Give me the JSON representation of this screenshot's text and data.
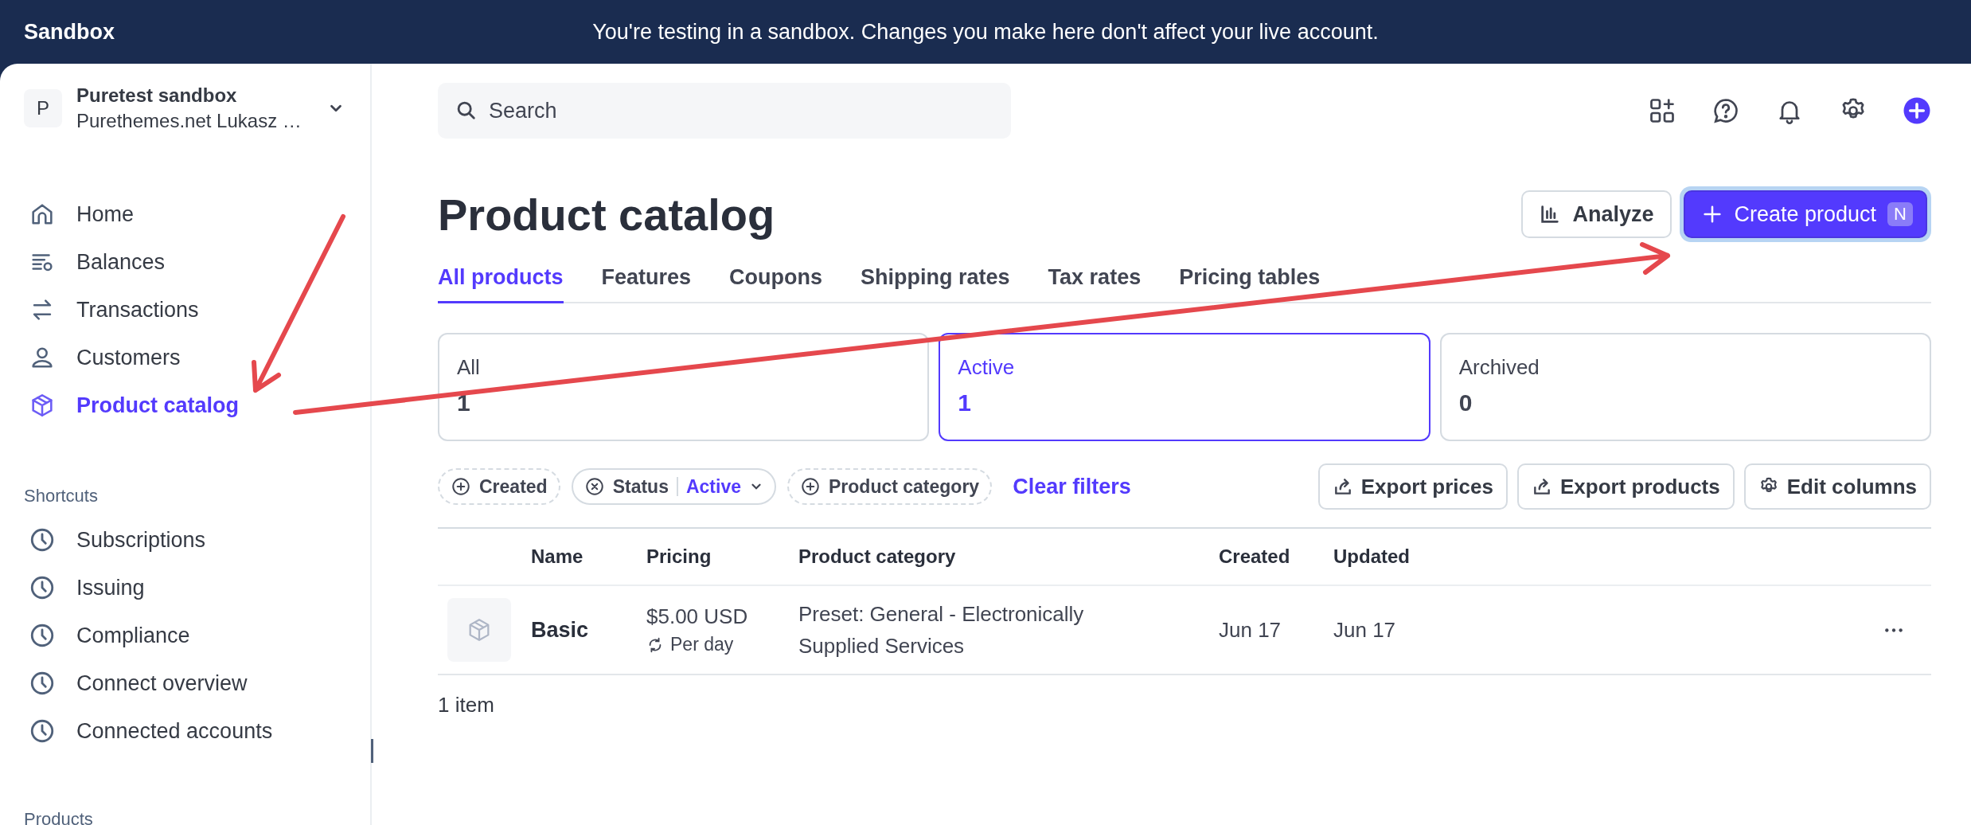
{
  "banner": {
    "label": "Sandbox",
    "message": "You're testing in a sandbox. Changes you make here don't affect your live account."
  },
  "account": {
    "initial": "P",
    "name": "Puretest sandbox",
    "subtitle": "Purethemes.net Lukasz …"
  },
  "nav": [
    {
      "label": "Home",
      "kind": "home",
      "selected": false
    },
    {
      "label": "Balances",
      "kind": "balances",
      "selected": false
    },
    {
      "label": "Transactions",
      "kind": "transfer",
      "selected": false
    },
    {
      "label": "Customers",
      "kind": "person",
      "selected": false
    },
    {
      "label": "Product catalog",
      "kind": "box",
      "selected": true
    }
  ],
  "shortcuts": {
    "title": "Shortcuts",
    "items": [
      {
        "label": "Subscriptions",
        "selected": false
      },
      {
        "label": "Issuing",
        "selected": false
      },
      {
        "label": "Compliance",
        "selected": false
      },
      {
        "label": "Connect overview",
        "selected": false
      },
      {
        "label": "Connected accounts",
        "selected": false
      }
    ]
  },
  "products_heading": "Products",
  "search": {
    "placeholder": "Search"
  },
  "header_icons": [
    {
      "kind": "apps"
    },
    {
      "kind": "help"
    },
    {
      "kind": "bell"
    },
    {
      "kind": "settings"
    },
    {
      "kind": "add"
    }
  ],
  "page_title": "Product catalog",
  "actions": [
    {
      "kind": "secondary",
      "label": "Analyze"
    },
    {
      "kind": "primary",
      "label": "Create product",
      "shortcut": "N"
    }
  ],
  "tabs": [
    {
      "label": "All products",
      "selected": true
    },
    {
      "label": "Features",
      "selected": false
    },
    {
      "label": "Coupons",
      "selected": false
    },
    {
      "label": "Shipping rates",
      "selected": false
    },
    {
      "label": "Tax rates",
      "selected": false
    },
    {
      "label": "Pricing tables",
      "selected": false
    }
  ],
  "status_cards": [
    {
      "label": "All",
      "count": "1",
      "selected": false
    },
    {
      "label": "Active",
      "count": "1",
      "selected": true
    },
    {
      "label": "Archived",
      "count": "0",
      "selected": false
    }
  ],
  "filters": [
    {
      "kind": "add",
      "label": "Created"
    },
    {
      "kind": "applied",
      "label": "Status",
      "value": "Active"
    },
    {
      "kind": "add",
      "label": "Product category"
    }
  ],
  "clear_filters": "Clear filters",
  "tools": [
    {
      "kind": "export",
      "label": "Export prices"
    },
    {
      "kind": "export",
      "label": "Export products"
    },
    {
      "kind": "settings",
      "label": "Edit columns"
    }
  ],
  "table": {
    "columns": [
      "Name",
      "Pricing",
      "Product category",
      "Created",
      "Updated"
    ],
    "rows": [
      {
        "name": "Basic",
        "price": "$5.00 USD",
        "interval": "Per day",
        "category": "Preset: General - Electronically Supplied Services",
        "created": "Jun 17",
        "updated": "Jun 17"
      }
    ]
  },
  "footer": "1 item"
}
